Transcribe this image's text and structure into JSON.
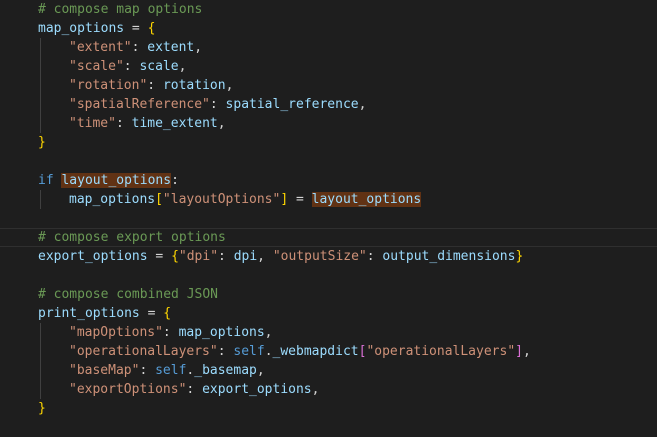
{
  "editor": {
    "background": "#1e1e1e",
    "colors": {
      "comment": "#6a9955",
      "variable": "#9cdcfe",
      "string": "#ce9178",
      "keyword": "#569cd6",
      "bracket_level_1": "#ffd700",
      "bracket_level_2": "#da70d6",
      "selection_highlight": "#613214"
    },
    "lines": [
      {
        "indent": 0,
        "tokens": [
          {
            "t": "# compose map options",
            "k": "comment"
          }
        ]
      },
      {
        "indent": 0,
        "tokens": [
          {
            "t": "map_options",
            "k": "ident"
          },
          {
            "t": " = ",
            "k": "text"
          },
          {
            "t": "{",
            "k": "br1"
          }
        ]
      },
      {
        "indent": 1,
        "tokens": [
          {
            "t": "\"extent\"",
            "k": "string"
          },
          {
            "t": ": ",
            "k": "text"
          },
          {
            "t": "extent",
            "k": "ident"
          },
          {
            "t": ",",
            "k": "text"
          }
        ]
      },
      {
        "indent": 1,
        "tokens": [
          {
            "t": "\"scale\"",
            "k": "string"
          },
          {
            "t": ": ",
            "k": "text"
          },
          {
            "t": "scale",
            "k": "ident"
          },
          {
            "t": ",",
            "k": "text"
          }
        ]
      },
      {
        "indent": 1,
        "tokens": [
          {
            "t": "\"rotation\"",
            "k": "string"
          },
          {
            "t": ": ",
            "k": "text"
          },
          {
            "t": "rotation",
            "k": "ident"
          },
          {
            "t": ",",
            "k": "text"
          }
        ]
      },
      {
        "indent": 1,
        "tokens": [
          {
            "t": "\"spatialReference\"",
            "k": "string"
          },
          {
            "t": ": ",
            "k": "text"
          },
          {
            "t": "spatial_reference",
            "k": "ident"
          },
          {
            "t": ",",
            "k": "text"
          }
        ]
      },
      {
        "indent": 1,
        "tokens": [
          {
            "t": "\"time\"",
            "k": "string"
          },
          {
            "t": ": ",
            "k": "text"
          },
          {
            "t": "time_extent",
            "k": "ident"
          },
          {
            "t": ",",
            "k": "text"
          }
        ]
      },
      {
        "indent": 0,
        "tokens": [
          {
            "t": "}",
            "k": "br1"
          }
        ]
      },
      {
        "indent": 0,
        "tokens": []
      },
      {
        "indent": 0,
        "tokens": [
          {
            "t": "if",
            "k": "keyword"
          },
          {
            "t": " ",
            "k": "text"
          },
          {
            "t": "layout_options",
            "k": "ident",
            "hl": true
          },
          {
            "t": ":",
            "k": "text"
          }
        ]
      },
      {
        "indent": 1,
        "tokens": [
          {
            "t": "map_options",
            "k": "ident"
          },
          {
            "t": "[",
            "k": "br1"
          },
          {
            "t": "\"layoutOptions\"",
            "k": "string"
          },
          {
            "t": "]",
            "k": "br1"
          },
          {
            "t": " = ",
            "k": "text"
          },
          {
            "t": "layout_options",
            "k": "ident",
            "hl": true
          }
        ]
      },
      {
        "indent": 0,
        "tokens": []
      },
      {
        "indent": 0,
        "current": true,
        "tokens": [
          {
            "t": "# compose export options",
            "k": "comment"
          }
        ]
      },
      {
        "indent": 0,
        "tokens": [
          {
            "t": "export_options",
            "k": "ident"
          },
          {
            "t": " = ",
            "k": "text"
          },
          {
            "t": "{",
            "k": "br1"
          },
          {
            "t": "\"dpi\"",
            "k": "string"
          },
          {
            "t": ": ",
            "k": "text"
          },
          {
            "t": "dpi",
            "k": "ident"
          },
          {
            "t": ", ",
            "k": "text"
          },
          {
            "t": "\"outputSize\"",
            "k": "string"
          },
          {
            "t": ": ",
            "k": "text"
          },
          {
            "t": "output_dimensions",
            "k": "ident"
          },
          {
            "t": "}",
            "k": "br1"
          }
        ]
      },
      {
        "indent": 0,
        "tokens": []
      },
      {
        "indent": 0,
        "tokens": [
          {
            "t": "# compose combined JSON",
            "k": "comment"
          }
        ]
      },
      {
        "indent": 0,
        "tokens": [
          {
            "t": "print_options",
            "k": "ident"
          },
          {
            "t": " = ",
            "k": "text"
          },
          {
            "t": "{",
            "k": "br1"
          }
        ]
      },
      {
        "indent": 1,
        "tokens": [
          {
            "t": "\"mapOptions\"",
            "k": "string"
          },
          {
            "t": ": ",
            "k": "text"
          },
          {
            "t": "map_options",
            "k": "ident"
          },
          {
            "t": ",",
            "k": "text"
          }
        ]
      },
      {
        "indent": 1,
        "tokens": [
          {
            "t": "\"operationalLayers\"",
            "k": "string"
          },
          {
            "t": ": ",
            "k": "text"
          },
          {
            "t": "self",
            "k": "keyword"
          },
          {
            "t": ".",
            "k": "text"
          },
          {
            "t": "_webmapdict",
            "k": "ident"
          },
          {
            "t": "[",
            "k": "br2"
          },
          {
            "t": "\"operationalLayers\"",
            "k": "string"
          },
          {
            "t": "]",
            "k": "br2"
          },
          {
            "t": ",",
            "k": "text"
          }
        ]
      },
      {
        "indent": 1,
        "tokens": [
          {
            "t": "\"baseMap\"",
            "k": "string"
          },
          {
            "t": ": ",
            "k": "text"
          },
          {
            "t": "self",
            "k": "keyword"
          },
          {
            "t": ".",
            "k": "text"
          },
          {
            "t": "_basemap",
            "k": "ident"
          },
          {
            "t": ",",
            "k": "text"
          }
        ]
      },
      {
        "indent": 1,
        "tokens": [
          {
            "t": "\"exportOptions\"",
            "k": "string"
          },
          {
            "t": ": ",
            "k": "text"
          },
          {
            "t": "export_options",
            "k": "ident"
          },
          {
            "t": ",",
            "k": "text"
          }
        ]
      },
      {
        "indent": 0,
        "tokens": [
          {
            "t": "}",
            "k": "br1"
          }
        ]
      }
    ]
  }
}
